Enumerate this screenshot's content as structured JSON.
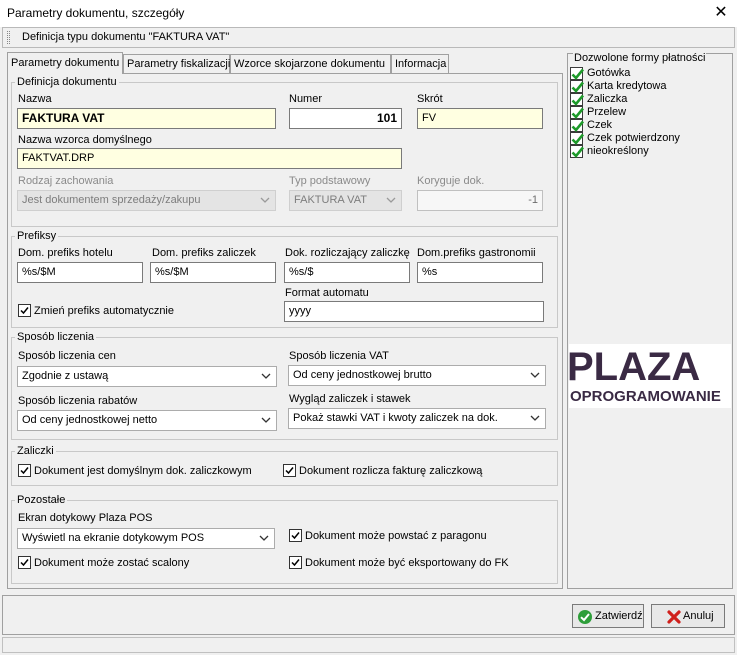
{
  "window": {
    "title": "Parametry dokumentu, szczegóły"
  },
  "defbar": {
    "text": "Definicja typu dokumentu \"FAKTURA VAT\""
  },
  "tabs": [
    {
      "label": "Parametry dokumentu"
    },
    {
      "label": "Parametry fiskalizacji"
    },
    {
      "label": "Wzorce skojarzone dokumentu"
    },
    {
      "label": "Informacja"
    }
  ],
  "definicja": {
    "group_label": "Definicja dokumentu",
    "nazwa_label": "Nazwa",
    "nazwa_value": "FAKTURA VAT",
    "numer_label": "Numer",
    "numer_value": "101",
    "skrot_label": "Skrót",
    "skrot_value": "FV",
    "wzorzec_label": "Nazwa wzorca domyślnego",
    "wzorzec_value": "FAKTVAT.DRP",
    "rodzaj_label": "Rodzaj zachowania",
    "rodzaj_value": "Jest dokumentem sprzedaży/zakupu",
    "typ_label": "Typ podstawowy",
    "typ_value": "FAKTURA VAT",
    "koryguje_label": "Koryguje dok.",
    "koryguje_value": "-1"
  },
  "prefiksy": {
    "group_label": "Prefiksy",
    "hotel_label": "Dom. prefiks hotelu",
    "hotel_value": "%s/$M",
    "zaliczek_label": "Dom. prefiks zaliczek",
    "zaliczek_value": "%s/$M",
    "rozlicz_label": "Dok. rozliczający zaliczkę",
    "rozlicz_value": "%s/$",
    "gastro_label": "Dom.prefiks gastronomii",
    "gastro_value": "%s",
    "zmien_label": "Zmień prefiks automatycznie",
    "format_label": "Format automatu",
    "format_value": "yyyy"
  },
  "sposob": {
    "group_label": "Sposób liczenia",
    "cen_label": "Sposób liczenia cen",
    "cen_value": "Zgodnie z ustawą",
    "vat_label": "Sposób liczenia VAT",
    "vat_value": "Od ceny jednostkowej brutto",
    "rabatow_label": "Sposób liczenia rabatów",
    "rabatow_value": "Od ceny jednostkowej netto",
    "wyglad_label": "Wygląd zaliczek i stawek",
    "wyglad_value": "Pokaż stawki VAT i kwoty zaliczek na dok."
  },
  "zaliczki": {
    "group_label": "Zaliczki",
    "domyslny_label": "Dokument jest domyślnym dok. zaliczkowym",
    "rozlicza_label": "Dokument rozlicza fakturę zaliczkową"
  },
  "pozostale": {
    "group_label": "Pozostałe",
    "ekran_label": "Ekran dotykowy Plaza POS",
    "ekran_value": "Wyświetl na ekranie dotykowym POS",
    "paragon_label": "Dokument może powstać z paragonu",
    "scalony_label": "Dokument może zostać scalony",
    "eksport_label": "Dokument może być eksportowany do FK"
  },
  "payments": {
    "title": "Dozwolone formy płatności",
    "items": [
      {
        "label": "Gotówka"
      },
      {
        "label": "Karta kredytowa"
      },
      {
        "label": "Zaliczka"
      },
      {
        "label": "Przelew"
      },
      {
        "label": "Czek"
      },
      {
        "label": "Czek potwierdzony"
      },
      {
        "label": "nieokreślony"
      }
    ]
  },
  "logo": {
    "text_main": "PLAZA",
    "text_sub": "OPROGRAMOWANIE"
  },
  "buttons": {
    "ok_label": "Zatwierdź",
    "cancel_label": "Anuluj"
  },
  "colors": {
    "check_green": "#1d9a2a",
    "logo_dark": "#3a2a44",
    "logo_red": "#e8343a",
    "cancel_red": "#d0201c"
  }
}
